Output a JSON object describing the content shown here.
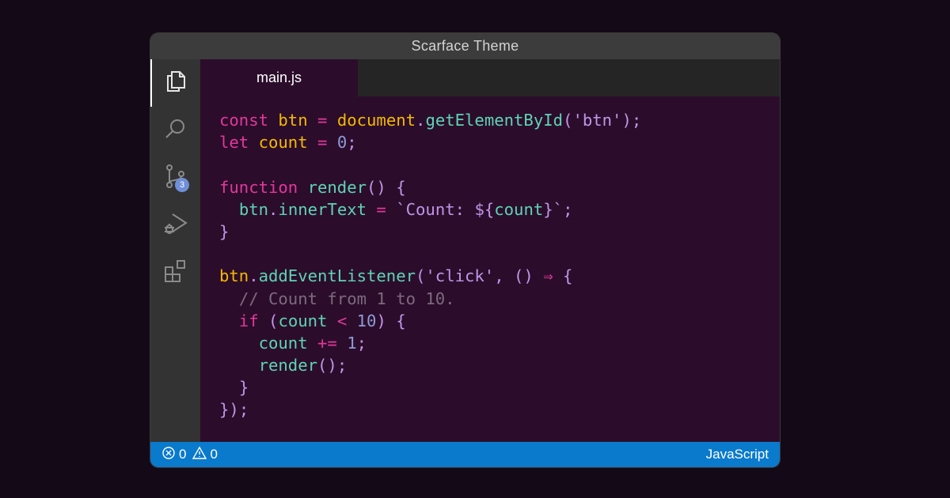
{
  "window": {
    "title": "Scarface Theme"
  },
  "activity_bar": {
    "items": [
      {
        "name": "explorer",
        "icon": "files-icon",
        "active": true
      },
      {
        "name": "search",
        "icon": "search-icon"
      },
      {
        "name": "source-control",
        "icon": "source-control-icon",
        "badge": "3"
      },
      {
        "name": "run-debug",
        "icon": "run-debug-icon"
      },
      {
        "name": "extensions",
        "icon": "extensions-icon"
      }
    ]
  },
  "tabs": [
    {
      "label": "main.js",
      "active": true
    }
  ],
  "colors": {
    "keyword": "#e2379b",
    "variable": "#f5b800",
    "function": "#5fd3b4",
    "string": "#c195e8",
    "number": "#8e9bd6",
    "comment": "#7d6a7e",
    "punctuation": "#c195e8",
    "editor_bg": "#2b0d2b",
    "status_bg": "#0a7acc"
  },
  "code": [
    [
      [
        "keyword",
        "const"
      ],
      [
        "plain",
        " "
      ],
      [
        "variable",
        "btn"
      ],
      [
        "plain",
        " "
      ],
      [
        "keyword",
        "="
      ],
      [
        "plain",
        " "
      ],
      [
        "variable",
        "document"
      ],
      [
        "punctuation",
        "."
      ],
      [
        "function",
        "getElementById"
      ],
      [
        "punctuation",
        "("
      ],
      [
        "string",
        "'btn'"
      ],
      [
        "punctuation",
        ")"
      ],
      [
        "punctuation",
        ";"
      ]
    ],
    [
      [
        "keyword",
        "let"
      ],
      [
        "plain",
        " "
      ],
      [
        "variable",
        "count"
      ],
      [
        "plain",
        " "
      ],
      [
        "keyword",
        "="
      ],
      [
        "plain",
        " "
      ],
      [
        "number",
        "0"
      ],
      [
        "punctuation",
        ";"
      ]
    ],
    [],
    [
      [
        "keyword",
        "function"
      ],
      [
        "plain",
        " "
      ],
      [
        "function",
        "render"
      ],
      [
        "punctuation",
        "()"
      ],
      [
        "plain",
        " "
      ],
      [
        "punctuation",
        "{"
      ]
    ],
    [
      [
        "plain",
        "  "
      ],
      [
        "function",
        "btn"
      ],
      [
        "punctuation",
        "."
      ],
      [
        "function",
        "innerText"
      ],
      [
        "plain",
        " "
      ],
      [
        "keyword",
        "="
      ],
      [
        "plain",
        " "
      ],
      [
        "string",
        "`Count: "
      ],
      [
        "punctuation",
        "${"
      ],
      [
        "function",
        "count"
      ],
      [
        "punctuation",
        "}"
      ],
      [
        "string",
        "`"
      ],
      [
        "punctuation",
        ";"
      ]
    ],
    [
      [
        "punctuation",
        "}"
      ]
    ],
    [],
    [
      [
        "variable",
        "btn"
      ],
      [
        "punctuation",
        "."
      ],
      [
        "function",
        "addEventListener"
      ],
      [
        "punctuation",
        "("
      ],
      [
        "string",
        "'click'"
      ],
      [
        "punctuation",
        ","
      ],
      [
        "plain",
        " "
      ],
      [
        "punctuation",
        "()"
      ],
      [
        "plain",
        " "
      ],
      [
        "keyword",
        "⇒"
      ],
      [
        "plain",
        " "
      ],
      [
        "punctuation",
        "{"
      ]
    ],
    [
      [
        "plain",
        "  "
      ],
      [
        "comment",
        "// Count from 1 to 10."
      ]
    ],
    [
      [
        "plain",
        "  "
      ],
      [
        "keyword",
        "if"
      ],
      [
        "plain",
        " "
      ],
      [
        "punctuation",
        "("
      ],
      [
        "function",
        "count"
      ],
      [
        "plain",
        " "
      ],
      [
        "keyword",
        "<"
      ],
      [
        "plain",
        " "
      ],
      [
        "number",
        "10"
      ],
      [
        "punctuation",
        ")"
      ],
      [
        "plain",
        " "
      ],
      [
        "punctuation",
        "{"
      ]
    ],
    [
      [
        "plain",
        "    "
      ],
      [
        "function",
        "count"
      ],
      [
        "plain",
        " "
      ],
      [
        "keyword",
        "+="
      ],
      [
        "plain",
        " "
      ],
      [
        "number",
        "1"
      ],
      [
        "punctuation",
        ";"
      ]
    ],
    [
      [
        "plain",
        "    "
      ],
      [
        "function",
        "render"
      ],
      [
        "punctuation",
        "()"
      ],
      [
        "punctuation",
        ";"
      ]
    ],
    [
      [
        "plain",
        "  "
      ],
      [
        "punctuation",
        "}"
      ]
    ],
    [
      [
        "punctuation",
        "})"
      ],
      [
        "punctuation",
        ";"
      ]
    ]
  ],
  "status_bar": {
    "errors": "0",
    "warnings": "0",
    "language": "JavaScript"
  }
}
